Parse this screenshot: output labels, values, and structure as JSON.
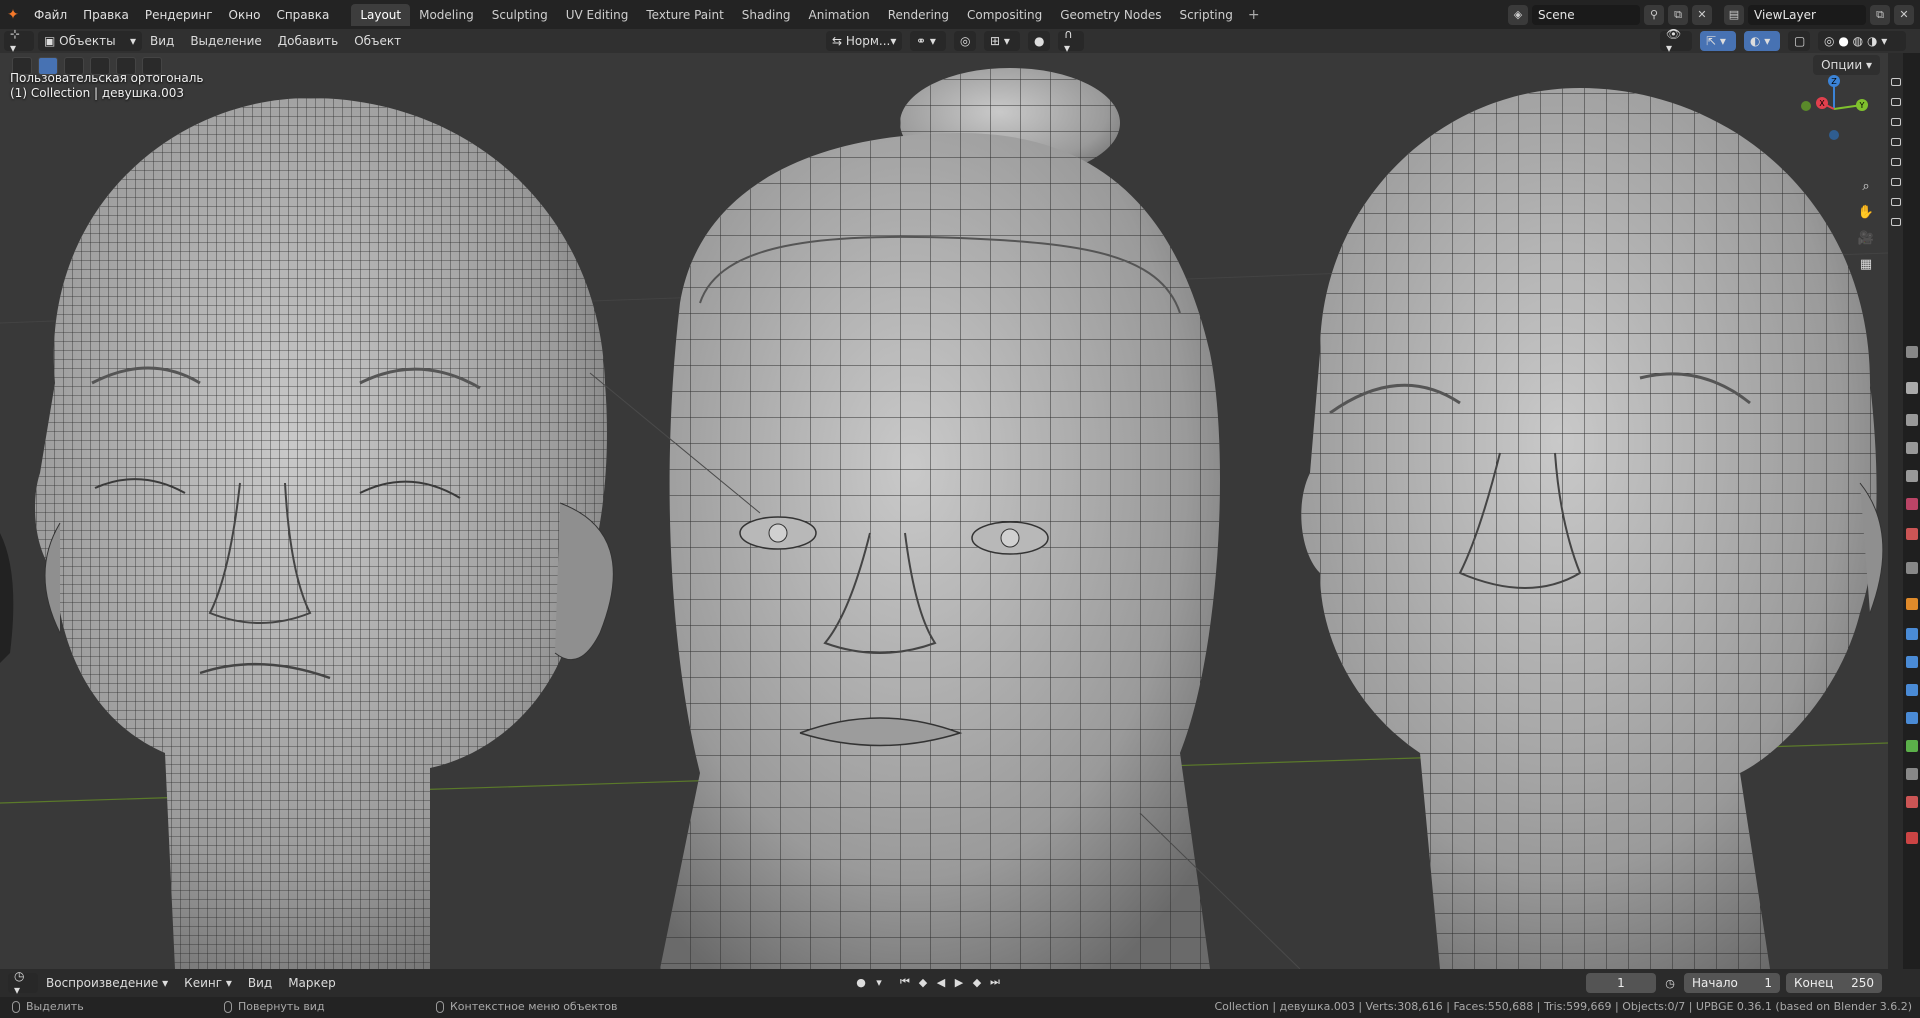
{
  "menu": [
    "Файл",
    "Правка",
    "Рендеринг",
    "Окно",
    "Справка"
  ],
  "workspace_tabs": [
    "Layout",
    "Modeling",
    "Sculpting",
    "UV Editing",
    "Texture Paint",
    "Shading",
    "Animation",
    "Rendering",
    "Compositing",
    "Geometry Nodes",
    "Scripting"
  ],
  "active_tab": "Layout",
  "scene_name": "Scene",
  "view_layer": "ViewLayer",
  "header": {
    "mode": "Объекты",
    "menu": [
      "Вид",
      "Выделение",
      "Добавить",
      "Объект"
    ],
    "orientation": "Норм...",
    "options": "Опции"
  },
  "viewport": {
    "view_name": "Пользовательская ортогональ",
    "collection_info": "(1) Collection | девушка.003",
    "gizmo": {
      "x": "X",
      "y": "Y",
      "z": "Z"
    }
  },
  "timeline": {
    "playback": "Воспроизведение",
    "keying": "Кеинг",
    "view": "Вид",
    "marker": "Маркер",
    "current_frame": "1",
    "start_label": "Начало",
    "start": "1",
    "end_label": "Конец",
    "end": "250"
  },
  "statusbar": {
    "select": "Выделить",
    "rotate": "Повернуть вид",
    "context": "Контекстное меню объектов",
    "stats": "Collection | девушка.003 | Verts:308,616 | Faces:550,688 | Tris:599,669 | Objects:0/7 | UPBGE 0.36.1 (based on Blender 3.6.2)"
  },
  "colors": {
    "accent": "#4772b3",
    "x_axis": "#e0404d",
    "y_axis": "#7fc12d",
    "z_axis": "#3b83d6",
    "viewport_bg": "#393939"
  }
}
